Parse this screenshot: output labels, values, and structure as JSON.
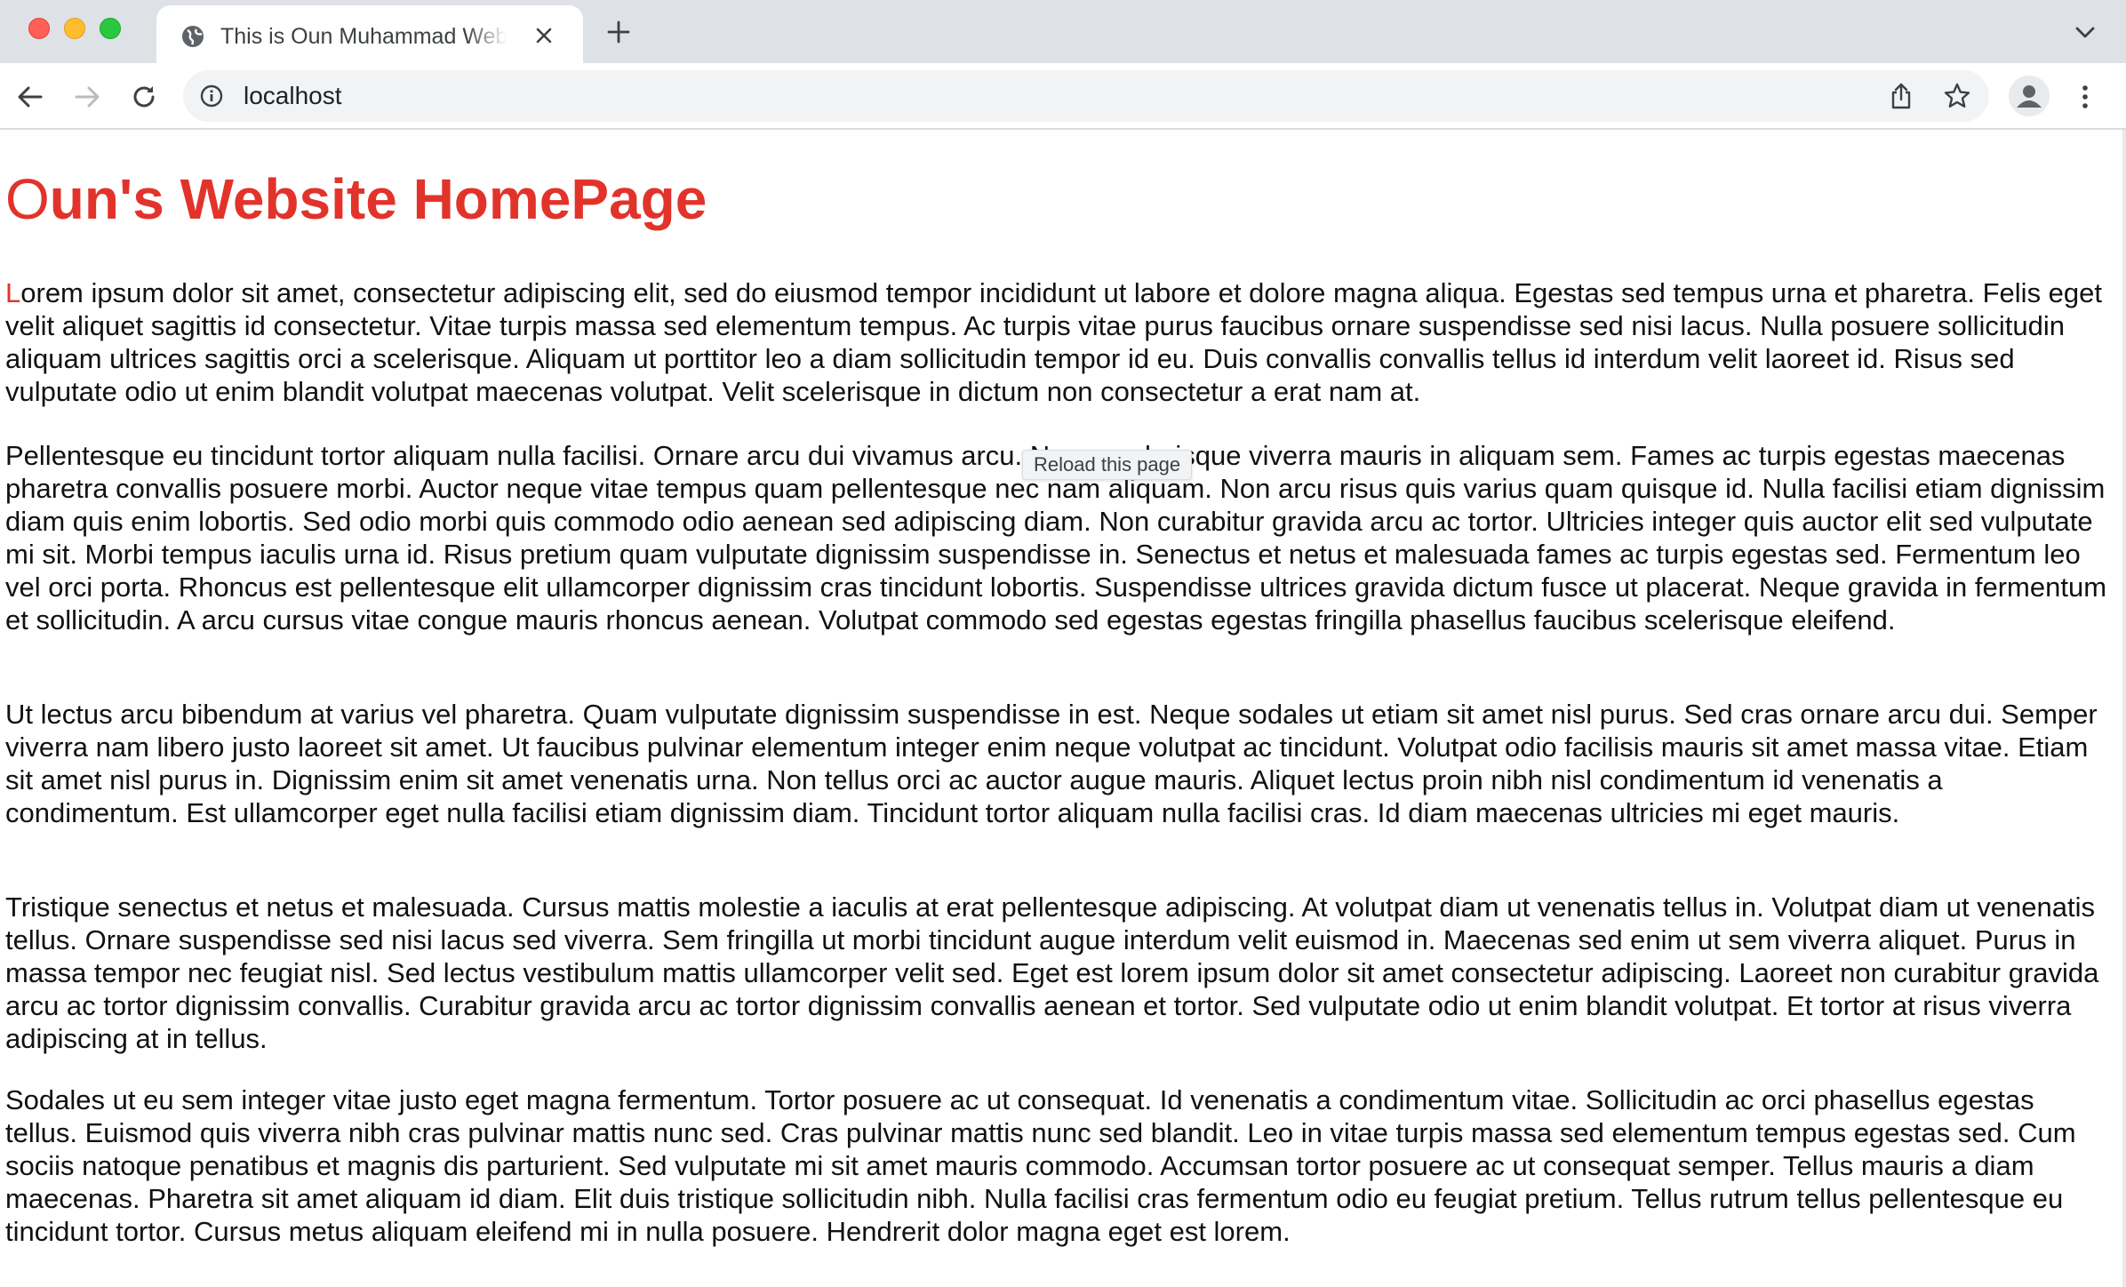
{
  "browser": {
    "tab": {
      "title": "This is Oun Muhammad Website"
    },
    "address_bar": {
      "url": "localhost"
    },
    "tooltip": "Reload this page",
    "icons": {
      "favicon": "globe-icon",
      "tab_close": "close-icon",
      "new_tab": "plus-icon",
      "tab_search": "chevron-down-icon",
      "back": "arrow-left-icon",
      "forward": "arrow-right-icon",
      "reload": "reload-icon",
      "site_info": "info-icon",
      "share": "share-icon",
      "bookmark": "star-icon",
      "profile": "profile-icon",
      "menu": "kebab-menu-icon"
    }
  },
  "page": {
    "title_first": "O",
    "title_rest": "un's Website HomePage",
    "paragraphs": [
      {
        "first": "L",
        "rest": "orem ipsum dolor sit amet, consectetur adipiscing elit, sed do eiusmod tempor incididunt ut labore et dolore magna aliqua. Egestas sed tempus urna et pharetra. Felis eget velit aliquet sagittis id consectetur. Vitae turpis massa sed elementum tempus. Ac turpis vitae purus faucibus ornare suspendisse sed nisi lacus. Nulla posuere sollicitudin aliquam ultrices sagittis orci a scelerisque. Aliquam ut porttitor leo a diam sollicitudin tempor id eu. Duis convallis convallis tellus id interdum velit laoreet id. Risus sed vulputate odio ut enim blandit volutpat maecenas volutpat. Velit scelerisque in dictum non consectetur a erat nam at."
      },
      {
        "first": "",
        "rest": "Pellentesque eu tincidunt tortor aliquam nulla facilisi. Ornare arcu dui vivamus arcu. Nunc scelerisque viverra mauris in aliquam sem. Fames ac turpis egestas maecenas pharetra convallis posuere morbi. Auctor neque vitae tempus quam pellentesque nec nam aliquam. Non arcu risus quis varius quam quisque id. Nulla facilisi etiam dignissim diam quis enim lobortis. Sed odio morbi quis commodo odio aenean sed adipiscing diam. Non curabitur gravida arcu ac tortor. Ultricies integer quis auctor elit sed vulputate mi sit. Morbi tempus iaculis urna id. Risus pretium quam vulputate dignissim suspendisse in. Senectus et netus et malesuada fames ac turpis egestas sed. Fermentum leo vel orci porta. Rhoncus est pellentesque elit ullamcorper dignissim cras tincidunt lobortis. Suspendisse ultrices gravida dictum fusce ut placerat. Neque gravida in fermentum et sollicitudin. A arcu cursus vitae congue mauris rhoncus aenean. Volutpat commodo sed egestas egestas fringilla phasellus faucibus scelerisque eleifend."
      },
      {
        "first": "",
        "rest": "Ut lectus arcu bibendum at varius vel pharetra. Quam vulputate dignissim suspendisse in est. Neque sodales ut etiam sit amet nisl purus. Sed cras ornare arcu dui. Semper viverra nam libero justo laoreet sit amet. Ut faucibus pulvinar elementum integer enim neque volutpat ac tincidunt. Volutpat odio facilisis mauris sit amet massa vitae. Etiam sit amet nisl purus in. Dignissim enim sit amet venenatis urna. Non tellus orci ac auctor augue mauris. Aliquet lectus proin nibh nisl condimentum id venenatis a condimentum. Est ullamcorper eget nulla facilisi etiam dignissim diam. Tincidunt tortor aliquam nulla facilisi cras. Id diam maecenas ultricies mi eget mauris."
      },
      {
        "first": "",
        "rest": "Tristique senectus et netus et malesuada. Cursus mattis molestie a iaculis at erat pellentesque adipiscing. At volutpat diam ut venenatis tellus in. Volutpat diam ut venenatis tellus. Ornare suspendisse sed nisi lacus sed viverra. Sem fringilla ut morbi tincidunt augue interdum velit euismod in. Maecenas sed enim ut sem viverra aliquet. Purus in massa tempor nec feugiat nisl. Sed lectus vestibulum mattis ullamcorper velit sed. Eget est lorem ipsum dolor sit amet consectetur adipiscing. Laoreet non curabitur gravida arcu ac tortor dignissim convallis. Curabitur gravida arcu ac tortor dignissim convallis aenean et tortor. Sed vulputate odio ut enim blandit volutpat. Et tortor at risus viverra adipiscing at in tellus."
      },
      {
        "first": "",
        "rest": "Sodales ut eu sem integer vitae justo eget magna fermentum. Tortor posuere ac ut consequat. Id venenatis a condimentum vitae. Sollicitudin ac orci phasellus egestas tellus. Euismod quis viverra nibh cras pulvinar mattis nunc sed. Cras pulvinar mattis nunc sed blandit. Leo in vitae turpis massa sed elementum tempus egestas sed. Cum sociis natoque penatibus et magnis dis parturient. Sed vulputate mi sit amet mauris commodo. Accumsan tortor posuere ac ut consequat semper. Tellus mauris a diam maecenas. Pharetra sit amet aliquam id diam. Elit duis tristique sollicitudin nibh. Nulla facilisi cras fermentum odio eu feugiat pretium. Tellus rutrum tellus pellentesque eu tincidunt tortor. Cursus metus aliquam eleifend mi in nulla posuere. Hendrerit dolor magna eget est lorem."
      }
    ]
  },
  "colors": {
    "accent_red": "#e2332b",
    "chrome_bg": "#dee1e6",
    "omnibox_bg": "#f1f3f4",
    "body_text": "#111111"
  }
}
